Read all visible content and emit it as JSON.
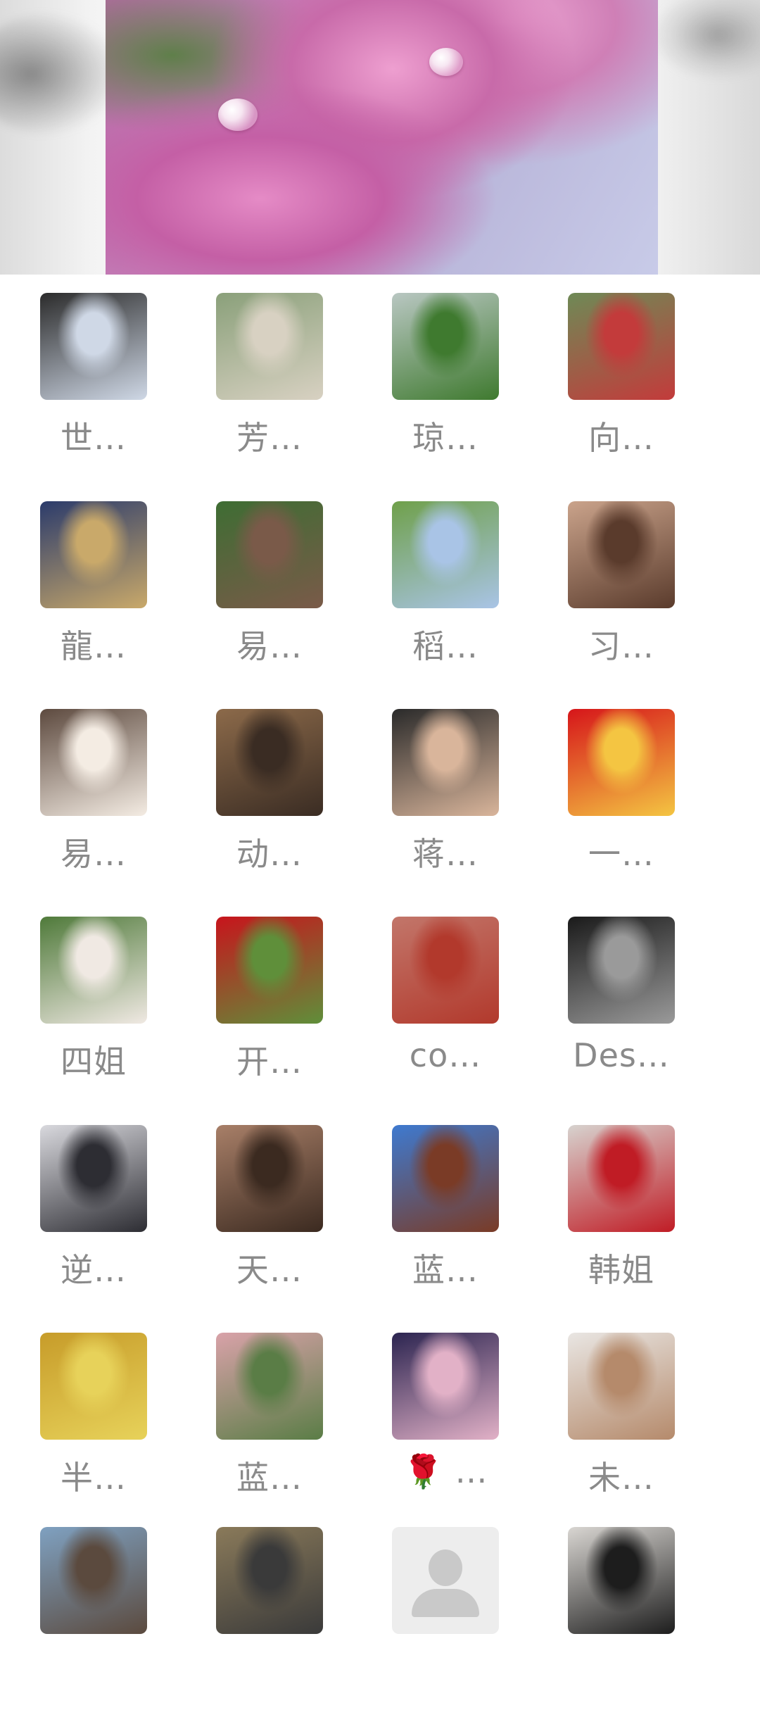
{
  "header": {
    "cover_image": "pink roses with water droplets",
    "background": "ink wash"
  },
  "members": [
    {
      "name": "世…",
      "avatar": "man-sunglasses-hat",
      "colors": [
        "#2b2b2b",
        "#cfd8e6"
      ]
    },
    {
      "name": "芳…",
      "avatar": "park-gate-woman",
      "colors": [
        "#8aa07a",
        "#d8d1c2"
      ]
    },
    {
      "name": "琼…",
      "avatar": "green-fields",
      "colors": [
        "#b9c7c2",
        "#3f7a2f"
      ]
    },
    {
      "name": "向…",
      "avatar": "woman-red-dress-garden",
      "colors": [
        "#6e8a56",
        "#c33b3b"
      ]
    },
    {
      "name": "龍…",
      "avatar": "game-warrior",
      "colors": [
        "#2b3b6b",
        "#c9a96a"
      ]
    },
    {
      "name": "易…",
      "avatar": "topiary-dragon",
      "colors": [
        "#3e6d33",
        "#7a5a49"
      ]
    },
    {
      "name": "稻…",
      "avatar": "cartoon-girl-sitting",
      "colors": [
        "#6fa04a",
        "#a9c4e6"
      ]
    },
    {
      "name": "习…",
      "avatar": "woman-selfie",
      "colors": [
        "#caa38b",
        "#5a3b2c"
      ]
    },
    {
      "name": "易…",
      "avatar": "cartoon-lady-turban",
      "colors": [
        "#5d4a3f",
        "#f4ece3"
      ]
    },
    {
      "name": "动…",
      "avatar": "man-pulling",
      "colors": [
        "#8c6a4a",
        "#3a2c23"
      ]
    },
    {
      "name": "蒋…",
      "avatar": "man-portrait",
      "colors": [
        "#2a2a2a",
        "#d9b59b"
      ]
    },
    {
      "name": "一…",
      "avatar": "red-calligraphy-hu",
      "colors": [
        "#d6151a",
        "#f4c542"
      ]
    },
    {
      "name": "四姐",
      "avatar": "woman-smiling",
      "colors": [
        "#4f7a3a",
        "#f0e9e3"
      ]
    },
    {
      "name": "开…",
      "avatar": "cherries",
      "colors": [
        "#c8141c",
        "#5f8f3a"
      ]
    },
    {
      "name": "co…",
      "avatar": "red-desert-butte",
      "colors": [
        "#c2766a",
        "#b2392c"
      ]
    },
    {
      "name": "Des…",
      "avatar": "anime-girl-dark",
      "colors": [
        "#1a1a1a",
        "#9a9a9a"
      ]
    },
    {
      "name": "逆…",
      "avatar": "ink-swordsman",
      "colors": [
        "#d9d9de",
        "#2d2d33"
      ]
    },
    {
      "name": "天…",
      "avatar": "bronze-chariot",
      "colors": [
        "#a87f68",
        "#3b2a20"
      ]
    },
    {
      "name": "蓝…",
      "avatar": "soldier-salute",
      "colors": [
        "#3e7ad0",
        "#7a3b26"
      ]
    },
    {
      "name": "韩姐",
      "avatar": "woman-red-coat",
      "colors": [
        "#d7d3cf",
        "#c01c25"
      ]
    },
    {
      "name": "半…",
      "avatar": "woman-flowers",
      "colors": [
        "#c79c2a",
        "#e7d25a"
      ]
    },
    {
      "name": "蓝…",
      "avatar": "woman-park-path",
      "colors": [
        "#d9a2a9",
        "#5a7d46"
      ]
    },
    {
      "name": "🌹 …",
      "avatar": "three-singers",
      "colors": [
        "#2b2450",
        "#e2b1c7"
      ]
    },
    {
      "name": "未…",
      "avatar": "woman-long-hair",
      "colors": [
        "#e9e6e3",
        "#b58a6b"
      ]
    },
    {
      "name": "",
      "avatar": "man-seaside",
      "colors": [
        "#7fa1c1",
        "#5b4a3e"
      ]
    },
    {
      "name": "",
      "avatar": "man-pavilion",
      "colors": [
        "#8a7a5a",
        "#3a3a3a"
      ]
    },
    {
      "name": "",
      "avatar": "default-user",
      "colors": [
        "#ededed",
        "#c9c9c9"
      ]
    },
    {
      "name": "",
      "avatar": "bald-man-sunglasses",
      "colors": [
        "#d9d6d2",
        "#1d1d1d"
      ]
    }
  ]
}
